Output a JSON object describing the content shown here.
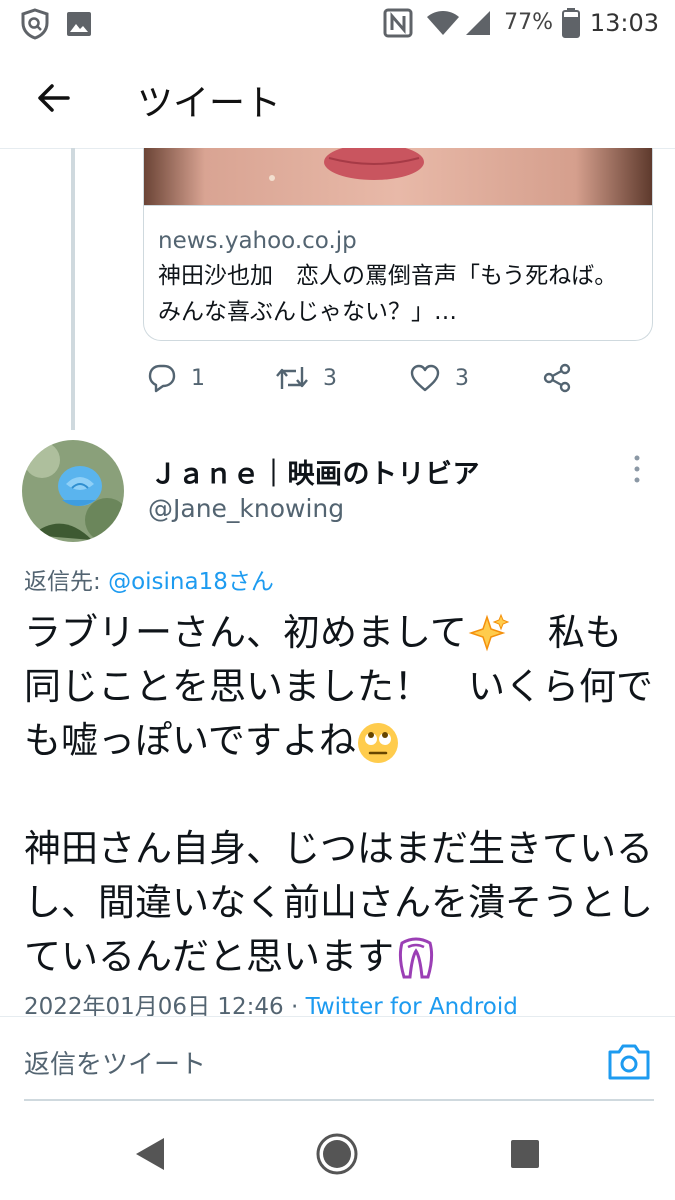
{
  "status_bar": {
    "time": "13:03",
    "battery_percent": "77%",
    "icons": [
      "shield-search-icon",
      "image-icon",
      "nfc-icon",
      "wifi-icon",
      "signal-icon",
      "battery-icon"
    ]
  },
  "header": {
    "title": "ツイート",
    "back_icon": "arrow-left-icon"
  },
  "link_card": {
    "domain": "news.yahoo.co.jp",
    "title": "神田沙也加　恋人の罵倒音声「もう死ねば。みんな喜ぶんじゃない？」…"
  },
  "actions": {
    "reply_count": "1",
    "retweet_count": "3",
    "like_count": "3"
  },
  "tweet": {
    "display_name": "Ｊａｎｅ｜映画のトリビア",
    "handle": "@Jane_knowing",
    "reply_to_label": "返信先: ",
    "reply_to_mention": "@oisina18さん",
    "text_line1": "ラブリーさん、初めまして",
    "text_line1b": "　私も同じことを思いました！　いくら何でも嘘っぽいですよね",
    "text_para2": "神田さん自身、じつはまだ生きているし、間違いなく前山さんを潰そうとしているんだと思います",
    "timestamp": "2022年01月06日 12:46",
    "separator": " · ",
    "client": "Twitter for Android"
  },
  "reply_bar": {
    "placeholder": "返信をツイート"
  },
  "colors": {
    "accent": "#1d9bf0",
    "secondary_text": "#536471",
    "primary_text": "#0f1419"
  }
}
